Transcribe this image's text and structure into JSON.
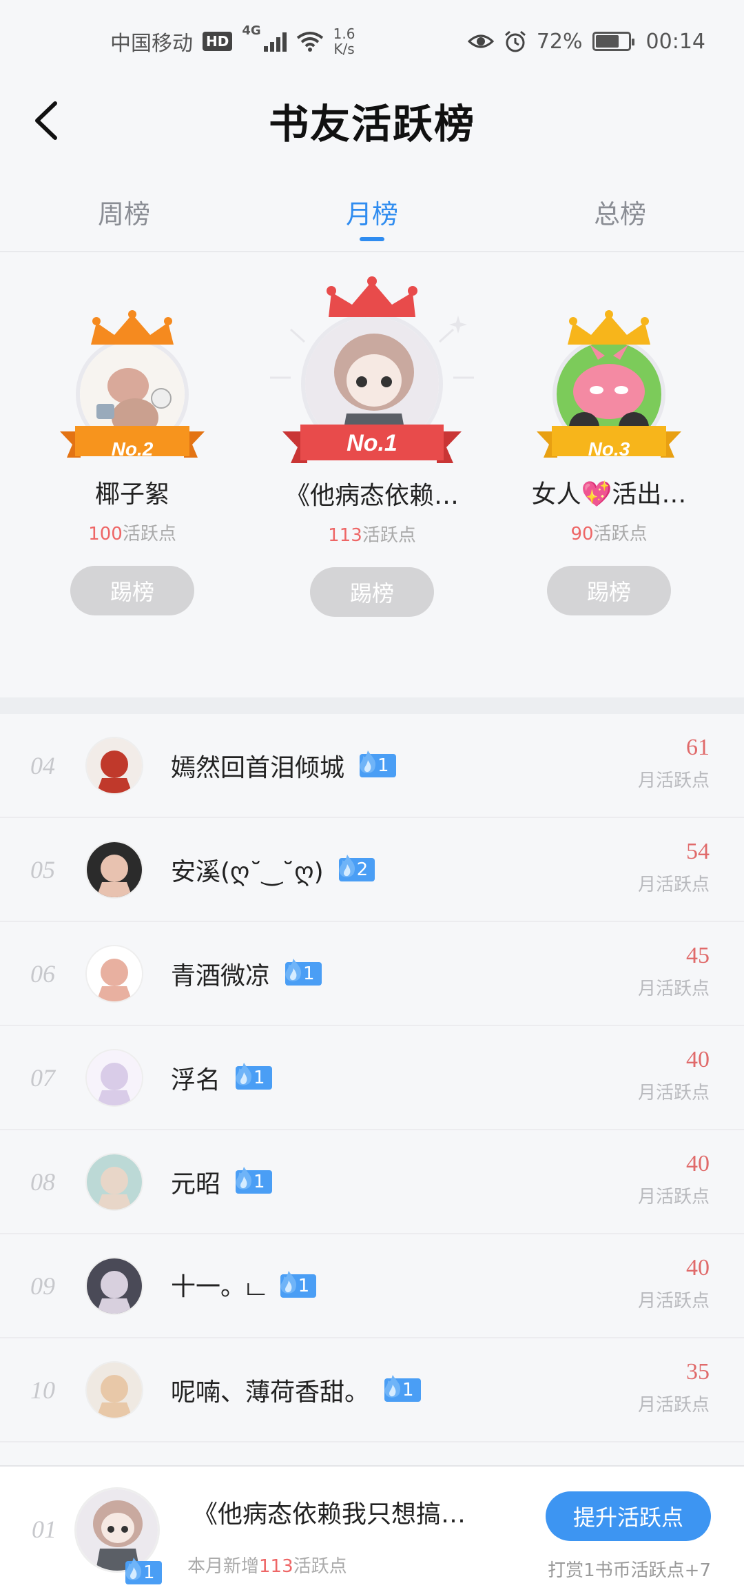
{
  "status_bar": {
    "carrier": "中国移动",
    "hd": "HD",
    "network": "4G",
    "speed_value": "1.6",
    "speed_unit": "K/s",
    "battery": "72%",
    "battery_level": 0.72,
    "time": "00:14"
  },
  "header": {
    "title": "书友活跃榜"
  },
  "tabs": [
    {
      "label": "周榜",
      "active": false
    },
    {
      "label": "月榜",
      "active": true
    },
    {
      "label": "总榜",
      "active": false
    }
  ],
  "top3": [
    {
      "rank_label": "No.2",
      "name": "椰子絮",
      "points": "100",
      "points_suffix": "活跃点",
      "button": "踢榜"
    },
    {
      "rank_label": "No.1",
      "name": "《他病态依赖…",
      "points": "113",
      "points_suffix": "活跃点",
      "button": "踢榜"
    },
    {
      "rank_label": "No.3",
      "name": "女人💖活出…",
      "points": "90",
      "points_suffix": "活跃点",
      "button": "踢榜"
    }
  ],
  "list": [
    {
      "rank": "04",
      "name": "嫣然回首泪倾城",
      "level": "1",
      "points": "61",
      "points_label": "月活跃点"
    },
    {
      "rank": "05",
      "name": "安溪(ღ˘‿˘ღ)",
      "level": "2",
      "points": "54",
      "points_label": "月活跃点"
    },
    {
      "rank": "06",
      "name": "青酒微凉",
      "level": "1",
      "points": "45",
      "points_label": "月活跃点"
    },
    {
      "rank": "07",
      "name": "浮名",
      "level": "1",
      "points": "40",
      "points_label": "月活跃点"
    },
    {
      "rank": "08",
      "name": "元昭",
      "level": "1",
      "points": "40",
      "points_label": "月活跃点"
    },
    {
      "rank": "09",
      "name": "十一。ட",
      "level": "1",
      "points": "40",
      "points_label": "月活跃点"
    },
    {
      "rank": "10",
      "name": "呢喃、薄荷香甜。",
      "level": "1",
      "points": "35",
      "points_label": "月活跃点"
    }
  ],
  "bottom": {
    "rank": "01",
    "name": "《他病态依赖我只想搞…",
    "level": "1",
    "sub_prefix": "本月新增",
    "sub_points": "113",
    "sub_suffix": "活跃点",
    "button": "提升活跃点",
    "tip": "打赏1书币活跃点+7"
  },
  "colors": {
    "accent": "#2f8cf0",
    "points_red": "#e06a6a",
    "gold": "#f7a21b",
    "red": "#e84b4b",
    "orange": "#f58a1f"
  },
  "icons": {
    "back": "chevron-left-icon",
    "eye": "eye-icon",
    "alarm": "alarm-icon",
    "wifi": "wifi-icon",
    "signal": "signal-icon",
    "battery": "battery-icon",
    "crown": "crown-icon",
    "flame": "flame-icon"
  }
}
